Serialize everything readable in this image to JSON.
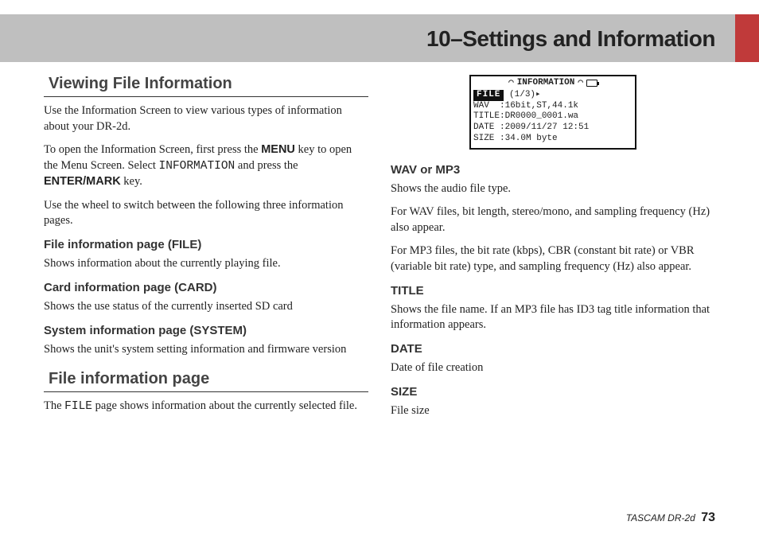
{
  "chapter_title": "10–Settings and Information",
  "left": {
    "h_viewing": "Viewing File Information",
    "p1a": "Use the Information Screen to view various types of information about your DR-2d.",
    "p2_pre": "To open the Information Screen, first press the ",
    "p2_menu": "MENU",
    "p2_mid1": " key to open the Menu Screen. Select ",
    "p2_info": "INFORMATION",
    "p2_mid2": " and press the ",
    "p2_enter": "ENTER/MARK",
    "p2_post": " key.",
    "p3": "Use the wheel to switch between the following three information pages.",
    "h_file": "File information page (FILE)",
    "p_file": "Shows information about the currently playing file.",
    "h_card": "Card information page (CARD)",
    "p_card": "Shows the use status of the currently inserted SD card",
    "h_system": "System information page (SYSTEM)",
    "p_system": "Shows the unit's system setting information and firmware version",
    "h_fileinfo": "File information page",
    "p_fip_pre": "The ",
    "p_fip_mono": "FILE",
    "p_fip_post": " page shows information about the currently selected file."
  },
  "lcd": {
    "title": "INFORMATION",
    "tab": "FILE",
    "tab_right": "(1/3)",
    "row_wav": "WAV  :16bit,ST,44.1k",
    "row_title": "TITLE:DR0000_0001.wa",
    "row_date": "DATE :2009/11/27 12:51",
    "row_size": "SIZE :34.0M byte"
  },
  "right": {
    "h_wav": "WAV or MP3",
    "p_wav1": "Shows the audio file type.",
    "p_wav2": "For WAV files, bit length, stereo/mono, and sampling frequency (Hz) also appear.",
    "p_wav3": "For MP3 files, the bit rate (kbps), CBR (constant bit rate) or VBR (variable bit rate) type, and sampling frequency (Hz) also appear.",
    "h_title": "TITLE",
    "p_title": "Shows the file name. If an MP3 file has ID3 tag title information that information appears.",
    "h_date": "DATE",
    "p_date": "Date of file creation",
    "h_size": "SIZE",
    "p_size": "File size"
  },
  "footer": {
    "brand": "TASCAM  DR-2d",
    "page": "73"
  }
}
